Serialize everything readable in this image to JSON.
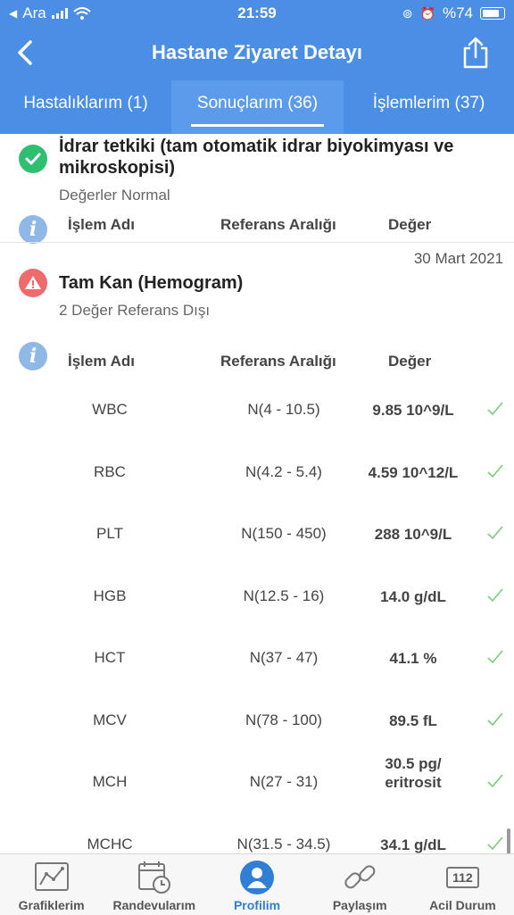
{
  "status_bar": {
    "carrier": "Ara",
    "time": "21:59",
    "battery": "%74"
  },
  "nav": {
    "title": "Hastane Ziyaret Detayı",
    "back_icon": "chevron-left-icon",
    "share_icon": "share-icon"
  },
  "tabs": [
    {
      "label": "Hastalıklarım (1)",
      "active": false
    },
    {
      "label": "Sonuçlarım (36)",
      "active": true
    },
    {
      "label": "İşlemlerim (37)",
      "active": false
    }
  ],
  "columns": {
    "name": "İşlem Adı",
    "ref": "Referans Aralığı",
    "value": "Değer"
  },
  "section1": {
    "title": "İdrar tetkiki (tam otomatik idrar biyokimyası ve mikroskopisi)",
    "subtitle": "Değerler Normal",
    "status_icon": "check-circle-icon"
  },
  "section2": {
    "date": "30 Mart 2021",
    "title": "Tam Kan (Hemogram)",
    "subtitle": "2 Değer Referans Dışı",
    "status_icon": "warning-icon",
    "rows": [
      {
        "name": "WBC",
        "ref": "N(4 - 10.5)",
        "value": "9.85 10^9/L"
      },
      {
        "name": "RBC",
        "ref": "N(4.2 - 5.4)",
        "value": "4.59 10^12/L"
      },
      {
        "name": "PLT",
        "ref": "N(150 - 450)",
        "value": "288 10^9/L"
      },
      {
        "name": "HGB",
        "ref": "N(12.5 - 16)",
        "value": "14.0 g/dL"
      },
      {
        "name": "HCT",
        "ref": "N(37 - 47)",
        "value": "41.1 %"
      },
      {
        "name": "MCV",
        "ref": "N(78 - 100)",
        "value": "89.5 fL"
      },
      {
        "name": "MCH",
        "ref": "N(27 - 31)",
        "value": "30.5 pg/ eritrosit"
      },
      {
        "name": "MCHC",
        "ref": "N(31.5 - 34.5)",
        "value": "34.1 g/dL"
      }
    ]
  },
  "bottom_nav": [
    {
      "label": "Grafiklerim",
      "icon": "chart-icon",
      "active": false
    },
    {
      "label": "Randevularım",
      "icon": "calendar-clock-icon",
      "active": false
    },
    {
      "label": "Profilim",
      "icon": "profile-icon",
      "active": true
    },
    {
      "label": "Paylaşım",
      "icon": "link-icon",
      "active": false
    },
    {
      "label": "Acil Durum",
      "icon": "emergency-112-icon",
      "badge": "112",
      "active": false
    }
  ],
  "colors": {
    "primary": "#4a8ee6",
    "ok": "#2fbf71",
    "warning": "#ef6b6b",
    "info": "#8fb8e6",
    "active_nav": "#2f7fd6"
  }
}
